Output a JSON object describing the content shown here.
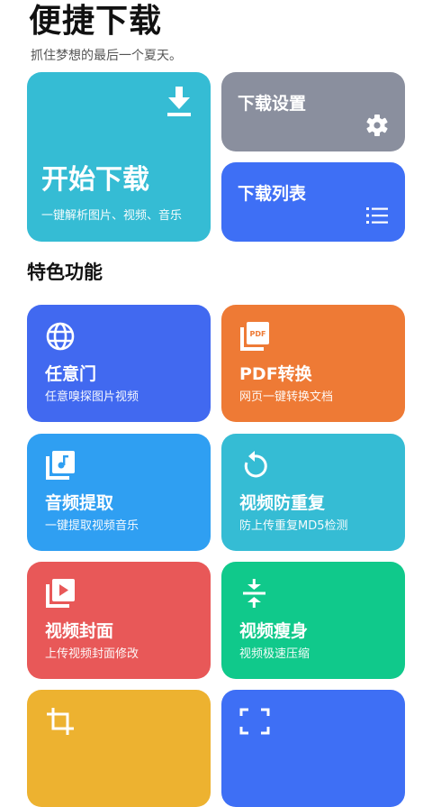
{
  "header": {
    "title": "便捷下载",
    "subtitle": "抓住梦想的最后一个夏天。"
  },
  "start": {
    "label": "开始下载",
    "sub": "一键解析图片、视频、音乐",
    "icon": "download-icon",
    "color": "#35bcd4"
  },
  "settings": {
    "label": "下载设置",
    "icon": "gear-icon",
    "color": "#8a8f9e"
  },
  "list": {
    "label": "下载列表",
    "icon": "list-icon",
    "color": "#3e6ff5"
  },
  "section": {
    "title": "特色功能"
  },
  "features": [
    {
      "title": "任意门",
      "sub": "任意嗅探图片视频",
      "icon": "globe-icon",
      "color": "#4169f0"
    },
    {
      "title": "PDF转换",
      "sub": "网页一键转换文档",
      "icon": "pdf-icon",
      "color": "#ee7a35"
    },
    {
      "title": "音频提取",
      "sub": "一键提取视频音乐",
      "icon": "music-library-icon",
      "color": "#2f9ff2"
    },
    {
      "title": "视频防重复",
      "sub": "防上传重复MD5检测",
      "icon": "replay-icon",
      "color": "#35bcd4"
    },
    {
      "title": "视频封面",
      "sub": "上传视频封面修改",
      "icon": "video-library-icon",
      "color": "#e85858"
    },
    {
      "title": "视频瘦身",
      "sub": "视频极速压缩",
      "icon": "compress-icon",
      "color": "#10c98b"
    },
    {
      "title": "",
      "sub": "",
      "icon": "crop-icon",
      "color": "#edb230"
    },
    {
      "title": "",
      "sub": "",
      "icon": "frame-icon",
      "color": "#3e6ff5"
    }
  ]
}
